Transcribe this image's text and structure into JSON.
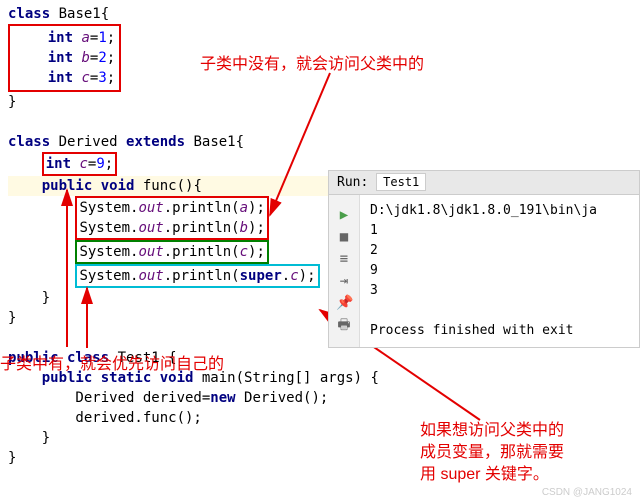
{
  "code": {
    "l01": "class Base1{",
    "l02": "    int a=1;",
    "l03": "    int b=2;",
    "l04": "    int c=3;",
    "l05": "}",
    "l06": "",
    "l07": "class Derived extends Base1{",
    "l08": "    int c=9;",
    "l09": "    public void func(){",
    "l10": "        System.out.println(a);",
    "l11": "        System.out.println(b);",
    "l12": "        System.out.println(c);",
    "l13": "        System.out.println(super.c);",
    "l14": "    }",
    "l15": "}",
    "l16": "",
    "l17": "public class Test1 {",
    "l18": "    public static void main(String[] args) {",
    "l19": "        Derived derived=new Derived();",
    "l20": "        derived.func();",
    "l21": "    }",
    "l22": "}"
  },
  "annotations": {
    "a1": "子类中没有，就会访问父类中的",
    "a2": "子类中有，就会优先访问自己的",
    "a3_line1": "如果想访问父类中的",
    "a3_line2": "成员变量，那就需要",
    "a3_line3": "用 super 关键字。"
  },
  "run": {
    "label": "Run:",
    "tab": "Test1",
    "path": "D:\\jdk1.8\\jdk1.8.0_191\\bin\\ja",
    "out1": "1",
    "out2": "2",
    "out3": "9",
    "out4": "3",
    "exit": "Process finished with exit"
  },
  "watermark": "CSDN @JANG1024"
}
